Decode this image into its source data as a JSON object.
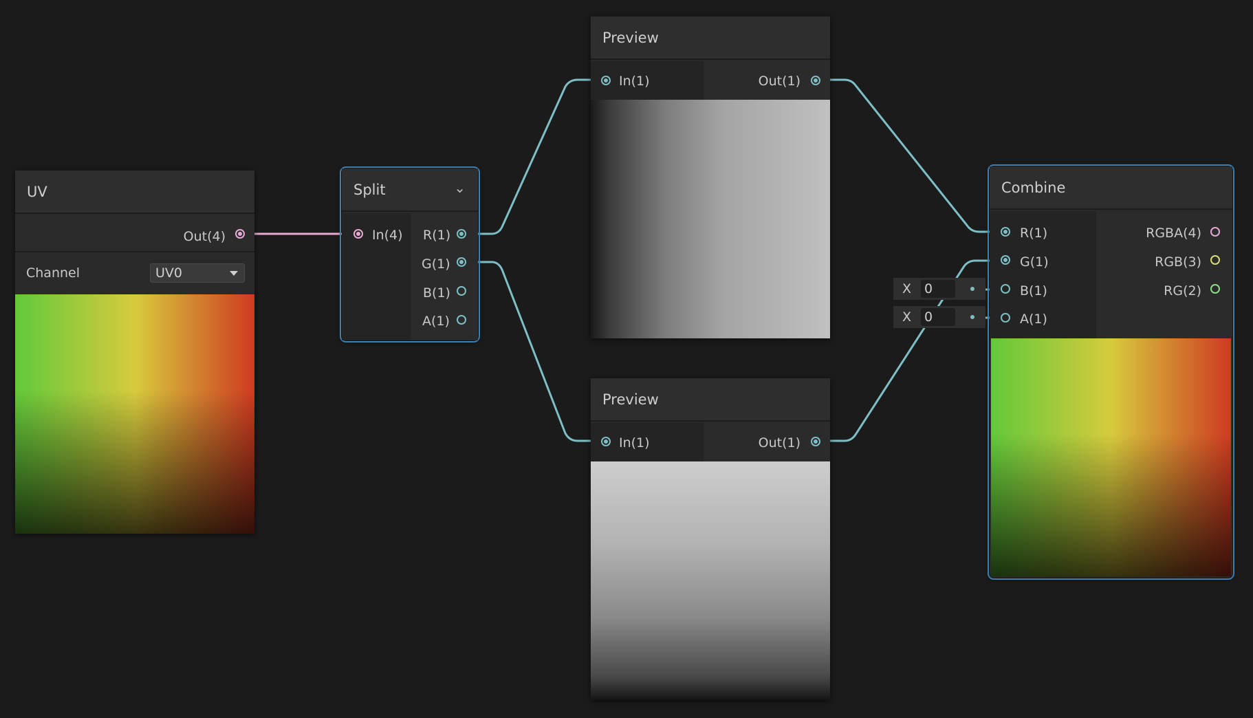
{
  "colors": {
    "background": "#1b1b1b",
    "wire_float": "#7ebfc6",
    "wire_vector4": "#e8a9d3",
    "selection": "#3e7fb0",
    "port_vector3": "#d9dd74",
    "port_vector2": "#8fdc8c"
  },
  "uv_node": {
    "title": "UV",
    "output": "Out(4)",
    "channel_label": "Channel",
    "channel_value": "UV0"
  },
  "split_node": {
    "title": "Split",
    "input": "In(4)",
    "outputs": [
      "R(1)",
      "G(1)",
      "B(1)",
      "A(1)"
    ]
  },
  "preview_top": {
    "title": "Preview",
    "input": "In(1)",
    "output": "Out(1)"
  },
  "preview_bottom": {
    "title": "Preview",
    "input": "In(1)",
    "output": "Out(1)"
  },
  "combine_node": {
    "title": "Combine",
    "inputs": [
      "R(1)",
      "G(1)",
      "B(1)",
      "A(1)"
    ],
    "outputs": [
      "RGBA(4)",
      "RGB(3)",
      "RG(2)"
    ]
  },
  "inline_b": {
    "axis": "X",
    "value": "0"
  },
  "inline_a": {
    "axis": "X",
    "value": "0"
  },
  "icons": [
    "chevron-down-icon",
    "dropdown-arrow-icon"
  ]
}
